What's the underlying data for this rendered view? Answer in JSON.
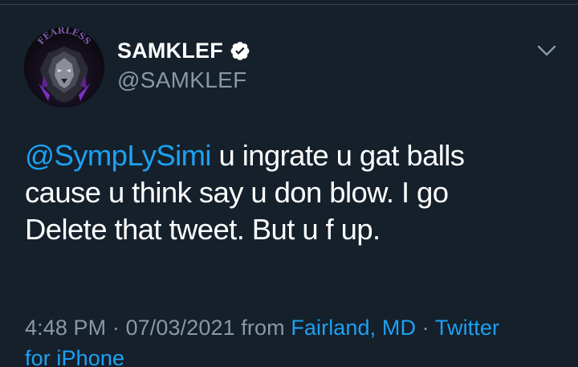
{
  "tweet": {
    "author": {
      "display_name": "SAMKLEF",
      "handle": "@SAMKLEF",
      "verified": true,
      "avatar_text": "FEARLESS"
    },
    "menu_icon": "chevron-down-icon",
    "body": {
      "mention": "@SympLySimi",
      "line1_rest": " u ingrate u gat balls",
      "line2": "cause u think say u don blow. I go",
      "line3": "Delete that tweet. But u f up."
    },
    "meta": {
      "time": "4:48 PM",
      "separator": " · ",
      "date": "07/03/2021",
      "from_word": " from ",
      "location": "Fairland, MD",
      "separator2": " · ",
      "source_line1": "Twitter",
      "source_line2": "for iPhone"
    }
  },
  "colors": {
    "background": "#15202b",
    "link": "#1da1f2",
    "secondary_text": "#8899a6",
    "primary_text": "#ffffff"
  }
}
